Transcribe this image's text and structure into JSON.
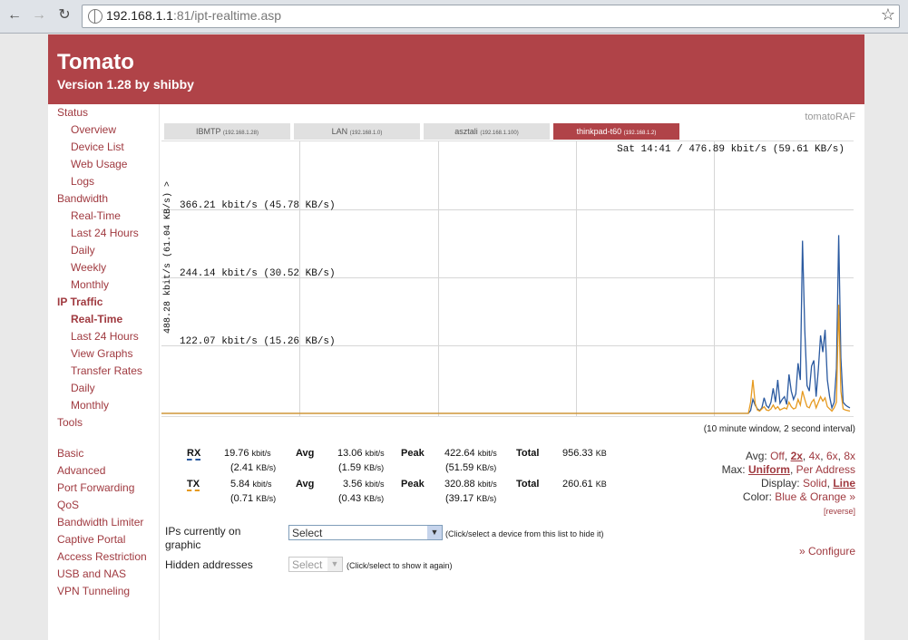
{
  "browser": {
    "url_host": "192.168.1.1",
    "url_rest": ":81/ipt-realtime.asp"
  },
  "header": {
    "title": "Tomato",
    "version": "Version 1.28 by shibby"
  },
  "brand_tag": "tomatoRAF",
  "colors": {
    "header": "#b04348",
    "rx": "#2b5aa0",
    "tx": "#e69a20",
    "link": "#a03a40"
  },
  "sidebar": {
    "items": [
      {
        "label": "Status",
        "type": "cat"
      },
      {
        "label": "Overview",
        "type": "sub"
      },
      {
        "label": "Device List",
        "type": "sub"
      },
      {
        "label": "Web Usage",
        "type": "sub"
      },
      {
        "label": "Logs",
        "type": "sub"
      },
      {
        "label": "Bandwidth",
        "type": "cat"
      },
      {
        "label": "Real-Time",
        "type": "sub"
      },
      {
        "label": "Last 24 Hours",
        "type": "sub"
      },
      {
        "label": "Daily",
        "type": "sub"
      },
      {
        "label": "Weekly",
        "type": "sub"
      },
      {
        "label": "Monthly",
        "type": "sub"
      },
      {
        "label": "IP Traffic",
        "type": "cat",
        "active": true
      },
      {
        "label": "Real-Time",
        "type": "sub",
        "active": true
      },
      {
        "label": "Last 24 Hours",
        "type": "sub"
      },
      {
        "label": "View Graphs",
        "type": "sub"
      },
      {
        "label": "Transfer Rates",
        "type": "sub"
      },
      {
        "label": "Daily",
        "type": "sub"
      },
      {
        "label": "Monthly",
        "type": "sub"
      },
      {
        "label": "Tools",
        "type": "cat"
      },
      {
        "label": "Basic",
        "type": "cat"
      },
      {
        "label": "Advanced",
        "type": "cat"
      },
      {
        "label": "Port Forwarding",
        "type": "cat"
      },
      {
        "label": "QoS",
        "type": "cat"
      },
      {
        "label": "Bandwidth Limiter",
        "type": "cat"
      },
      {
        "label": "Captive Portal",
        "type": "cat"
      },
      {
        "label": "Access Restriction",
        "type": "cat"
      },
      {
        "label": "USB and NAS",
        "type": "cat"
      },
      {
        "label": "VPN Tunneling",
        "type": "cat"
      }
    ]
  },
  "tabs": [
    {
      "name": "IBMTP",
      "ip": "(192.168.1.28)"
    },
    {
      "name": "LAN",
      "ip": "(192.168.1.0)"
    },
    {
      "name": "asztali",
      "ip": "(192.168.1.100)"
    },
    {
      "name": "thinkpad-t60",
      "ip": "(192.168.1.2)",
      "active": true
    }
  ],
  "graph": {
    "stamp": "Sat 14:41 / 476.89 kbit/s (59.61 KB/s)",
    "ymax_label": "488.28 kbit/s (61.04 KB/s) >",
    "grid_labels": [
      "366.21 kbit/s (45.78 KB/s)",
      "244.14 kbit/s (30.52 KB/s)",
      "122.07 kbit/s (15.26 KB/s)"
    ],
    "window_note": "(10 minute window, 2 second interval)"
  },
  "chart_data": {
    "type": "line",
    "title": "",
    "xlabel": "",
    "ylabel": "488.28 kbit/s (61.04 KB/s) >",
    "ylim": [
      0,
      488.28
    ],
    "grid": true,
    "series": [
      {
        "name": "RX",
        "values": [
          0,
          0,
          0,
          0,
          0,
          0,
          0,
          0,
          0,
          0,
          0,
          0,
          0,
          0,
          0,
          0,
          0,
          0,
          0,
          0,
          0,
          0,
          0,
          0,
          0,
          0,
          0,
          0,
          0,
          0,
          0,
          0,
          0,
          0,
          0,
          0,
          0,
          0,
          0,
          0,
          0,
          0,
          0,
          0,
          0,
          0,
          0,
          0,
          0,
          0,
          0,
          0,
          0,
          0,
          0,
          0,
          0,
          0,
          0,
          0,
          0,
          0,
          0,
          0,
          0,
          0,
          0,
          0,
          0,
          0,
          0,
          0,
          0,
          0,
          0,
          0,
          0,
          0,
          0,
          0,
          0,
          0,
          0,
          0,
          0,
          0,
          0,
          0,
          0,
          0,
          0,
          0,
          0,
          0,
          0,
          0,
          0,
          0,
          0,
          0,
          0,
          0,
          0,
          0,
          0,
          0,
          0,
          0,
          0,
          0,
          0,
          0,
          0,
          0,
          0,
          0,
          0,
          0,
          0,
          0,
          0,
          0,
          0,
          0,
          0,
          0,
          0,
          0,
          0,
          0,
          0,
          0,
          0,
          0,
          0,
          0,
          0,
          0,
          0,
          0,
          0,
          0,
          0,
          0,
          0,
          0,
          0,
          0,
          0,
          0,
          0,
          0,
          0,
          0,
          0,
          0,
          0,
          0,
          0,
          0,
          0,
          0,
          0,
          0,
          0,
          0,
          0,
          0,
          0,
          0,
          0,
          0,
          0,
          0,
          0,
          0,
          0,
          0,
          0,
          0,
          0,
          0,
          0,
          0,
          0,
          0,
          0,
          0,
          0,
          0,
          0,
          0,
          0,
          0,
          0,
          0,
          0,
          0,
          0,
          0,
          0,
          0,
          0,
          0,
          0,
          0,
          0,
          0,
          0,
          0,
          0,
          0,
          0,
          0,
          0,
          0,
          0,
          0,
          0,
          0,
          0,
          0,
          0,
          0,
          0,
          0,
          0,
          0,
          0,
          0,
          0,
          0,
          0,
          0,
          0,
          0,
          0,
          0,
          0,
          0,
          0,
          0,
          0,
          0,
          0,
          0,
          0,
          0,
          0,
          0,
          0,
          0,
          0,
          0,
          0,
          0,
          0,
          0,
          0,
          0,
          0,
          5,
          25,
          15,
          8,
          5,
          10,
          28,
          14,
          10,
          20,
          45,
          20,
          60,
          18,
          25,
          30,
          16,
          70,
          40,
          25,
          35,
          90,
          60,
          310,
          150,
          50,
          40,
          85,
          95,
          30,
          80,
          140,
          110,
          150,
          60,
          30,
          10,
          20,
          80,
          320,
          100,
          20,
          15,
          12,
          10
        ]
      },
      {
        "name": "TX",
        "values": [
          0,
          0,
          0,
          0,
          0,
          0,
          0,
          0,
          0,
          0,
          0,
          0,
          0,
          0,
          0,
          0,
          0,
          0,
          0,
          0,
          0,
          0,
          0,
          0,
          0,
          0,
          0,
          0,
          0,
          0,
          0,
          0,
          0,
          0,
          0,
          0,
          0,
          0,
          0,
          0,
          0,
          0,
          0,
          0,
          0,
          0,
          0,
          0,
          0,
          0,
          0,
          0,
          0,
          0,
          0,
          0,
          0,
          0,
          0,
          0,
          0,
          0,
          0,
          0,
          0,
          0,
          0,
          0,
          0,
          0,
          0,
          0,
          0,
          0,
          0,
          0,
          0,
          0,
          0,
          0,
          0,
          0,
          0,
          0,
          0,
          0,
          0,
          0,
          0,
          0,
          0,
          0,
          0,
          0,
          0,
          0,
          0,
          0,
          0,
          0,
          0,
          0,
          0,
          0,
          0,
          0,
          0,
          0,
          0,
          0,
          0,
          0,
          0,
          0,
          0,
          0,
          0,
          0,
          0,
          0,
          0,
          0,
          0,
          0,
          0,
          0,
          0,
          0,
          0,
          0,
          0,
          0,
          0,
          0,
          0,
          0,
          0,
          0,
          0,
          0,
          0,
          0,
          0,
          0,
          0,
          0,
          0,
          0,
          0,
          0,
          0,
          0,
          0,
          0,
          0,
          0,
          0,
          0,
          0,
          0,
          0,
          0,
          0,
          0,
          0,
          0,
          0,
          0,
          0,
          0,
          0,
          0,
          0,
          0,
          0,
          0,
          0,
          0,
          0,
          0,
          0,
          0,
          0,
          0,
          0,
          0,
          0,
          0,
          0,
          0,
          0,
          0,
          0,
          0,
          0,
          0,
          0,
          0,
          0,
          0,
          0,
          0,
          0,
          0,
          0,
          0,
          0,
          0,
          0,
          0,
          0,
          0,
          0,
          0,
          0,
          0,
          0,
          0,
          0,
          0,
          0,
          0,
          0,
          0,
          0,
          0,
          0,
          0,
          0,
          0,
          0,
          0,
          0,
          0,
          0,
          0,
          0,
          0,
          0,
          0,
          0,
          0,
          0,
          0,
          0,
          0,
          0,
          0,
          0,
          0,
          0,
          0,
          0,
          0,
          0,
          0,
          0,
          0,
          0,
          0,
          0,
          20,
          60,
          18,
          6,
          4,
          8,
          12,
          6,
          5,
          8,
          15,
          8,
          12,
          6,
          8,
          10,
          8,
          20,
          12,
          8,
          10,
          25,
          15,
          40,
          25,
          12,
          10,
          20,
          25,
          10,
          20,
          30,
          22,
          28,
          12,
          8,
          4,
          10,
          20,
          195,
          40,
          8,
          6,
          5,
          4
        ]
      }
    ]
  },
  "stats": {
    "rx": {
      "label": "RX",
      "rate": "19.76",
      "rate_kb": "(2.41",
      "avg_label": "Avg",
      "avg": "13.06",
      "avg_kb": "(1.59",
      "peak_label": "Peak",
      "peak": "422.64",
      "peak_kb": "(51.59",
      "total_label": "Total",
      "total": "956.33"
    },
    "tx": {
      "label": "TX",
      "rate": "5.84",
      "rate_kb": "(0.71",
      "avg_label": "Avg",
      "avg": "3.56",
      "avg_kb": "(0.43",
      "peak_label": "Peak",
      "peak": "320.88",
      "peak_kb": "(39.17",
      "total_label": "Total",
      "total": "260.61"
    },
    "unit_kbit": "kbit/s",
    "unit_kb": "KB/s)",
    "unit_total": "KB"
  },
  "options": {
    "avg_label": "Avg:",
    "avg_choices": [
      "Off",
      "2x",
      "4x",
      "6x",
      "8x"
    ],
    "avg_selected": "2x",
    "max_label": "Max:",
    "max_choices": [
      "Uniform",
      "Per Address"
    ],
    "max_selected": "Uniform",
    "display_label": "Display:",
    "display_choices": [
      "Solid",
      "Line"
    ],
    "display_selected": "Line",
    "color_label": "Color:",
    "color_value": "Blue & Orange »",
    "reverse": "[reverse]"
  },
  "form": {
    "ips_label_1": "IPs currently on",
    "ips_label_2": "graphic",
    "ips_select": "Select",
    "ips_hint": "(Click/select a device from this list to hide it)",
    "hidden_label": "Hidden addresses",
    "hidden_select": "Select",
    "hidden_hint": "(Click/select to show it again)",
    "configure": "» Configure"
  }
}
